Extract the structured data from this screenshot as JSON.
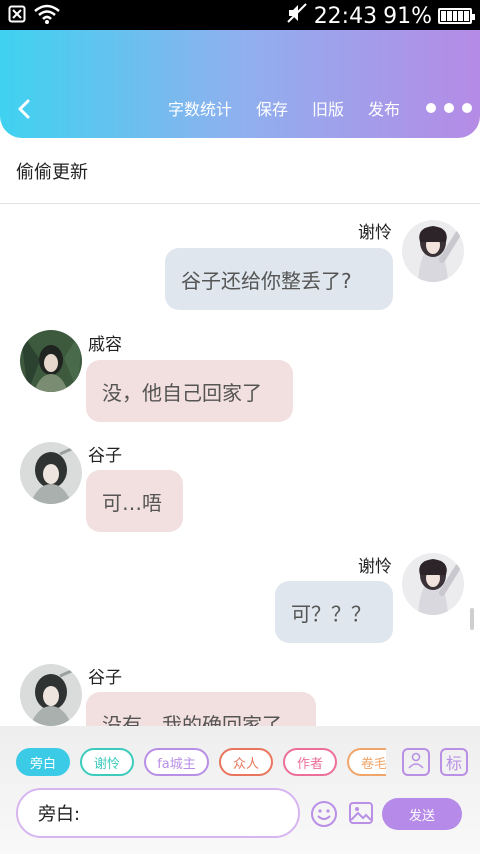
{
  "status_bar": {
    "time": "22:43",
    "battery": "91%"
  },
  "header": {
    "actions": [
      "字数统计",
      "保存",
      "旧版",
      "发布"
    ]
  },
  "document": {
    "title": "偷偷更新"
  },
  "messages": [
    {
      "side": "right",
      "speaker": "谢怜",
      "text": "谷子还给你整丢了?"
    },
    {
      "side": "left",
      "speaker": "戚容",
      "text": "没，他自己回家了"
    },
    {
      "side": "left",
      "speaker": "谷子",
      "text": "可…唔"
    },
    {
      "side": "right",
      "speaker": "谢怜",
      "text": "可？？？"
    },
    {
      "side": "left",
      "speaker": "谷子",
      "text": "没有，我的确回家了"
    }
  ],
  "toolbar": {
    "tags": [
      {
        "label": "旁白",
        "color": "#3ccbe6",
        "selected": true
      },
      {
        "label": "谢怜",
        "color": "#3ccbbd",
        "selected": false
      },
      {
        "label": "fa城主",
        "color": "#b98fe6",
        "selected": false
      },
      {
        "label": "众人",
        "color": "#e8765e",
        "selected": false
      },
      {
        "label": "作者",
        "color": "#ec6f9a",
        "selected": false
      },
      {
        "label": "卷毛",
        "color": "#f0a56a",
        "selected": false
      }
    ],
    "side_buttons": {
      "person": "",
      "mark": "标"
    },
    "input_value": "旁白:",
    "send_label": "发送"
  },
  "colors": {
    "header_gradient_start": "#3fd2f0",
    "header_gradient_end": "#b58be6",
    "right_bubble": "#dfe6ed",
    "left_bubble": "#f2dfdf",
    "accent": "#b68ae8"
  }
}
